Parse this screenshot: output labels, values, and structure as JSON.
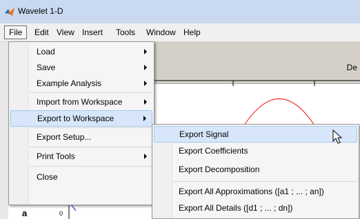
{
  "window": {
    "title": "Wavelet 1-D"
  },
  "menubar": {
    "items": [
      {
        "label": "File",
        "active": true
      },
      {
        "label": "Edit"
      },
      {
        "label": "View"
      },
      {
        "label": "Insert"
      },
      {
        "label": "Tools"
      },
      {
        "label": "Window"
      },
      {
        "label": "Help"
      }
    ]
  },
  "figure": {
    "header_text": "De",
    "axis_letter": "a",
    "axis_tick": "0"
  },
  "file_menu": {
    "items": [
      {
        "label": "Load",
        "submenu": true
      },
      {
        "label": "Save",
        "submenu": true
      },
      {
        "label": "Example Analysis",
        "submenu": true
      },
      {
        "label": "Import from Workspace",
        "submenu": true
      },
      {
        "label": "Export to Workspace",
        "submenu": true,
        "highlighted": true
      },
      {
        "label": "Export Setup..."
      },
      {
        "label": "Print Tools",
        "submenu": true
      },
      {
        "label": "Close"
      }
    ]
  },
  "export_submenu": {
    "items": [
      {
        "label": "Export Signal",
        "highlighted": true
      },
      {
        "label": "Export Coefficients"
      },
      {
        "label": "Export Decomposition"
      },
      {
        "label": "Export All Approximations ([a1 ; ... ; an])"
      },
      {
        "label": "Export All Details ([d1 ; ... ; dn])"
      }
    ]
  },
  "colors": {
    "title_bar": "#c9daf0",
    "highlight": "#d7e6fa",
    "curve": "#ff0000"
  }
}
